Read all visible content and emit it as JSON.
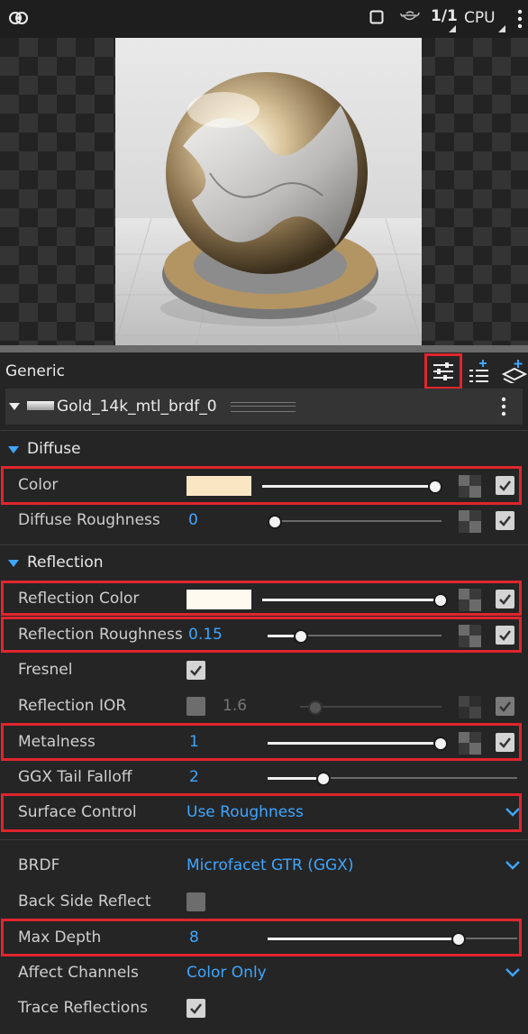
{
  "topbar": {
    "logo_icon": "link-rings-icon",
    "stop_icon": "square-icon",
    "teapot_icon": "teapot-icon",
    "ratio_label": "1/1",
    "device_label": "CPU",
    "menu_icon": "vertical-dots-icon"
  },
  "panel": {
    "title": "Generic",
    "material_name": "Gold_14k_mtl_brdf_0"
  },
  "sections": {
    "diffuse": "Diffuse",
    "reflection": "Reflection"
  },
  "rows": {
    "color": {
      "label": "Color",
      "swatch": "#fbe6c4",
      "level": 1.0,
      "enabled": true
    },
    "diffuse_roughness": {
      "label": "Diffuse Roughness",
      "value": "0",
      "level": 0.0,
      "enabled": true
    },
    "reflection_color": {
      "label": "Reflection Color",
      "swatch": "#fffaef",
      "level": 1.0,
      "enabled": true
    },
    "reflection_roughness": {
      "label": "Reflection Roughness",
      "value": "0.15",
      "level": 0.15,
      "enabled": true
    },
    "fresnel": {
      "label": "Fresnel",
      "checked": true
    },
    "reflection_ior": {
      "label": "Reflection IOR",
      "value": "1.6",
      "checked": false,
      "enabled": true
    },
    "metalness": {
      "label": "Metalness",
      "value": "1",
      "level": 1.0,
      "enabled": true
    },
    "ggx_tail_falloff": {
      "label": "GGX Tail Falloff",
      "value": "2"
    },
    "surface_control": {
      "label": "Surface Control",
      "value": "Use Roughness"
    },
    "brdf": {
      "label": "BRDF",
      "value": "Microfacet GTR (GGX)"
    },
    "back_side_reflect": {
      "label": "Back Side Reflect",
      "checked": false
    },
    "max_depth": {
      "label": "Max Depth",
      "value": "8"
    },
    "affect_channels": {
      "label": "Affect Channels",
      "value": "Color Only"
    },
    "trace_reflections": {
      "label": "Trace Reflections",
      "checked": true
    }
  },
  "colors": {
    "accent": "#3ea6ff",
    "highlight": "#e0252d",
    "panel_bg": "#252525"
  }
}
